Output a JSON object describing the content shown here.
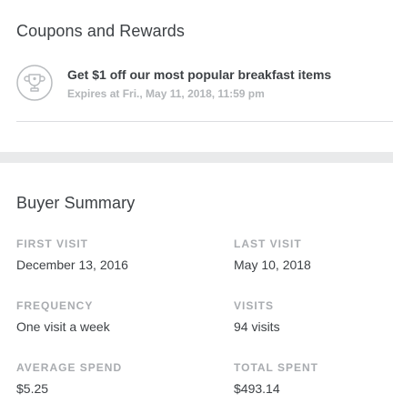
{
  "coupons": {
    "title": "Coupons and Rewards",
    "items": [
      {
        "icon": "trophy-icon",
        "title": "Get $1 off our most popular breakfast items",
        "expires": "Expires at Fri., May 11, 2018, 11:59 pm"
      }
    ]
  },
  "buyer_summary": {
    "title": "Buyer Summary",
    "first_visit": {
      "label": "FIRST VISIT",
      "value": "December 13, 2016"
    },
    "last_visit": {
      "label": "LAST VISIT",
      "value": "May 10, 2018"
    },
    "frequency": {
      "label": "FREQUENCY",
      "value": "One visit a week"
    },
    "visits": {
      "label": "VISITS",
      "value": "94 visits"
    },
    "average_spend": {
      "label": "AVERAGE SPEND",
      "value": "$5.25"
    },
    "total_spent": {
      "label": "TOTAL SPENT",
      "value": "$493.14"
    }
  },
  "colors": {
    "text_primary": "#3d4145",
    "text_muted": "#a9acb0",
    "divider": "#dcdde0",
    "section_band": "#e9eaeb",
    "icon_stroke": "#b9bcbf"
  }
}
